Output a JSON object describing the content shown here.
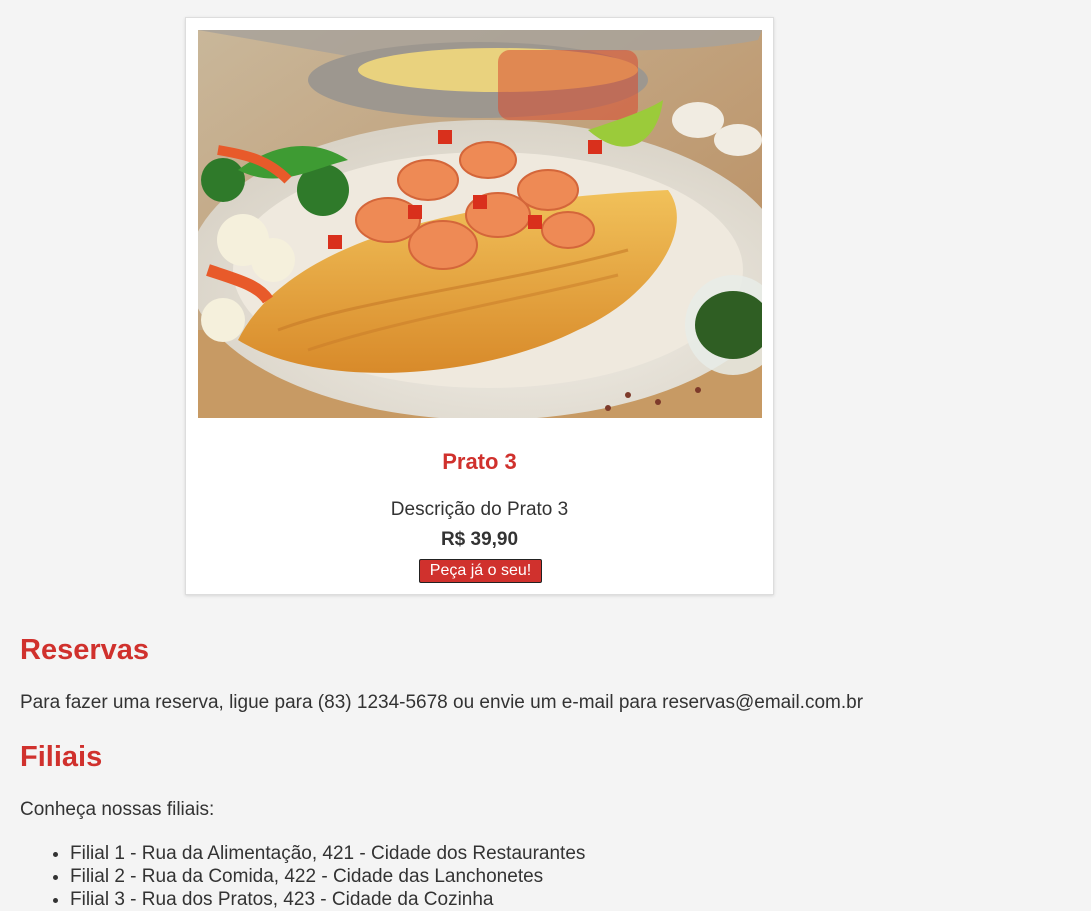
{
  "dish": {
    "image_alt": "Prato 3",
    "title": "Prato 3",
    "description": "Descrição do Prato 3",
    "price": "R$ 39,90",
    "order_button": "Peça já o seu!"
  },
  "reservas": {
    "heading": "Reservas",
    "text_prefix": "Para fazer uma reserva, ligue para (83) 1234-5678 ou envie um e-mail para ",
    "email": "reservas@email.com.br"
  },
  "filiais": {
    "heading": "Filiais",
    "intro": "Conheça nossas filiais:",
    "items": [
      "Filial 1 - Rua da Alimentação, 421 - Cidade dos Restaurantes",
      "Filial 2 - Rua da Comida, 422 - Cidade das Lanchonetes",
      "Filial 3 - Rua dos Pratos, 423 - Cidade da Cozinha"
    ]
  },
  "colors": {
    "accent": "#d0312d",
    "background": "#f4f4f4",
    "text": "#333333"
  }
}
